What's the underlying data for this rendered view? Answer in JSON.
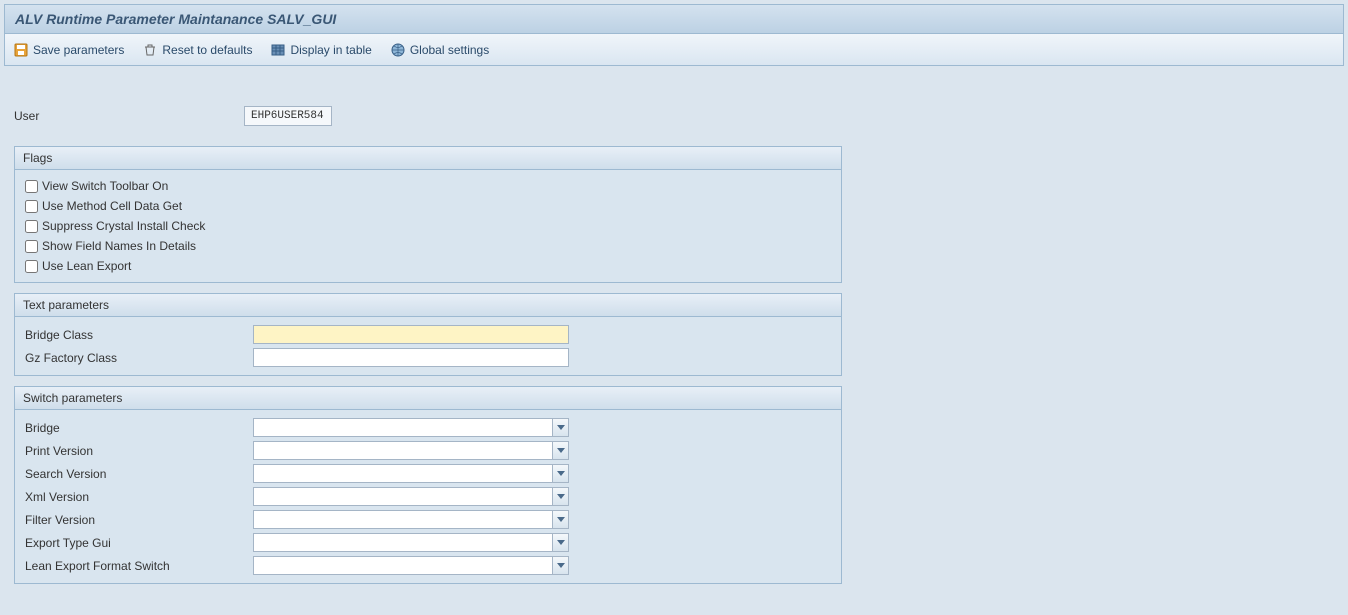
{
  "title": "ALV Runtime Parameter Maintanance SALV_GUI",
  "toolbar": {
    "save_label": "Save parameters",
    "reset_label": "Reset to defaults",
    "display_label": "Display in table",
    "global_label": "Global settings"
  },
  "user": {
    "label": "User",
    "value": "EHP6USER584"
  },
  "groups": {
    "flags": {
      "title": "Flags",
      "items": [
        {
          "label": "View Switch Toolbar On",
          "checked": false
        },
        {
          "label": "Use Method Cell Data Get",
          "checked": false
        },
        {
          "label": "Suppress Crystal Install Check",
          "checked": false
        },
        {
          "label": "Show Field Names In Details",
          "checked": false
        },
        {
          "label": "Use Lean Export",
          "checked": false
        }
      ]
    },
    "text_params": {
      "title": "Text parameters",
      "rows": [
        {
          "label": "Bridge Class",
          "value": "",
          "required": true
        },
        {
          "label": "Gz Factory Class",
          "value": "",
          "required": false
        }
      ]
    },
    "switch_params": {
      "title": "Switch parameters",
      "rows": [
        {
          "label": "Bridge",
          "value": ""
        },
        {
          "label": "Print Version",
          "value": ""
        },
        {
          "label": "Search Version",
          "value": ""
        },
        {
          "label": "Xml Version",
          "value": ""
        },
        {
          "label": "Filter Version",
          "value": ""
        },
        {
          "label": "Export Type Gui",
          "value": ""
        },
        {
          "label": "Lean Export Format Switch",
          "value": ""
        }
      ]
    }
  }
}
